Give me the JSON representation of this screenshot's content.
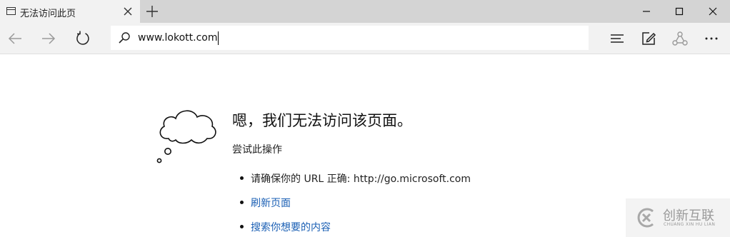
{
  "tab": {
    "title": "无法访问此页",
    "icon": "page-icon"
  },
  "window": {
    "icons": [
      "minimize-icon",
      "maximize-icon",
      "close-icon"
    ]
  },
  "toolbar": {
    "icons": [
      "back-arrow-icon",
      "forward-arrow-icon",
      "refresh-icon",
      "hub-icon",
      "web-note-icon",
      "share-icon",
      "more-icon"
    ]
  },
  "address_bar": {
    "value": "www.lokott.com",
    "icon": "search-icon"
  },
  "error_page": {
    "heading": "嗯，我们无法访问该页面。",
    "subheading": "尝试此操作",
    "suggestions": [
      {
        "text": "请确保你的 URL 正确: http://go.microsoft.com",
        "is_link": false
      },
      {
        "text": "刷新页面",
        "is_link": true
      },
      {
        "text": "搜索你想要的内容",
        "is_link": true
      }
    ],
    "illustration": "thought-cloud-icon"
  },
  "watermark": {
    "title": "创新互联",
    "subtitle": "CHUANG XIN HU LIAN"
  },
  "colors": {
    "tabbar_bg": "#d4d4d4",
    "active_tab_bg": "#f2f2f2",
    "toolbar_bg": "#f2f2f2",
    "link": "#1a5fb4"
  }
}
